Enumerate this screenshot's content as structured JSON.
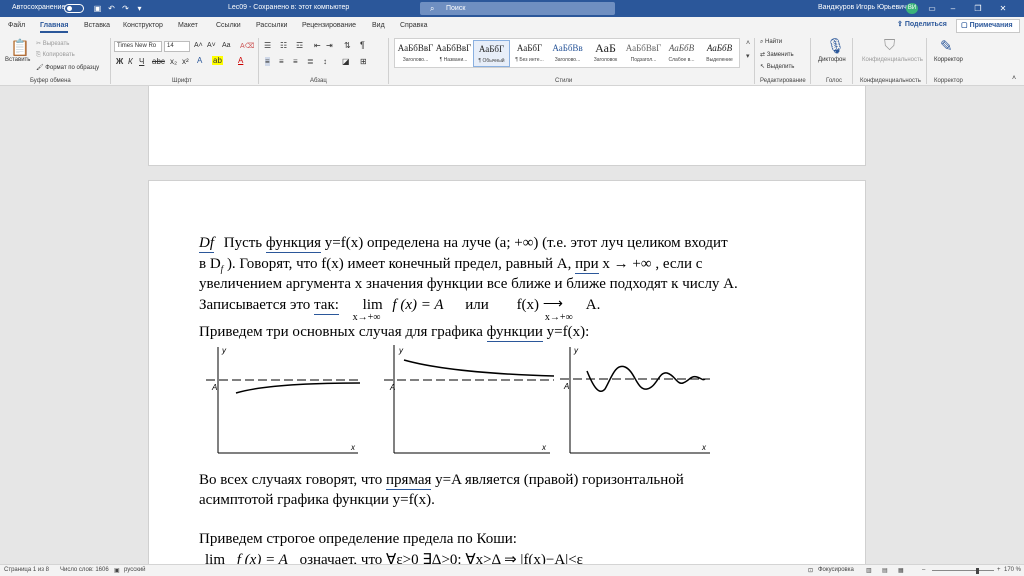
{
  "titlebar": {
    "autosave": "Автосохранение",
    "doc_title": "Lec09 - Сохранено в: этот компьютер",
    "search": "Поиск",
    "user": "Ванджуров Игорь Юрьевич",
    "avatar": "ВИ"
  },
  "tabs": [
    "Файл",
    "Главная",
    "Вставка",
    "Конструктор",
    "Макет",
    "Ссылки",
    "Рассылки",
    "Рецензирование",
    "Вид",
    "Справка"
  ],
  "share": "Поделиться",
  "notes": "Примечания",
  "ribbon": {
    "paste": "Вставить",
    "cut": "Вырезать",
    "copy": "Копировать",
    "format_painter": "Формат по образцу",
    "clipboard": "Буфер обмена",
    "font_name": "Times New Ro",
    "font_size": "14",
    "font_group": "Шрифт",
    "paragraph_group": "Абзац",
    "styles": [
      {
        "preview": "АаБбВвГ",
        "name": "Заголово..."
      },
      {
        "preview": "АаБбВвГ",
        "name": "¶ Названи..."
      },
      {
        "preview": "АаБбГ",
        "name": "¶ Обычный"
      },
      {
        "preview": "АаБбГ",
        "name": "¶ Без инте..."
      },
      {
        "preview": "АаБбВв",
        "name": "Заголово..."
      },
      {
        "preview": "АаБ",
        "name": "Заголовок"
      },
      {
        "preview": "АаБбВвГ",
        "name": "Подзагол..."
      },
      {
        "preview": "АаБбВ",
        "name": "Слабое в..."
      },
      {
        "preview": "АаБбВ",
        "name": "Выделение"
      }
    ],
    "styles_group": "Стили",
    "find": "Найти",
    "replace": "Заменить",
    "select": "Выделить",
    "editing_group": "Редактирование",
    "dictation": "Диктофон",
    "voice_group": "Голос",
    "sensitivity": "Конфиденциальность",
    "sensitivity_group": "Конфиденциальность",
    "editor": "Корректор",
    "editor_group": "Корректор"
  },
  "document": {
    "df": "Df",
    "line1_a": "Пусть",
    "line1_b": "функция",
    "line1_c": "y=f(x) определена на луче (a; +∞) (т.е. этот луч целиком входит",
    "line2_a": "в D",
    "line2_sub": "f",
    "line2_b": "). Говорят, что f(x) имеет конечный предел, равный A,",
    "line2_c": "при",
    "line2_d": "x → +∞ , если с",
    "line3": "увеличением аргумента x значения функции все ближе и ближе подходят к числу A.",
    "line4_a": "Записывается это",
    "line4_b": "так:",
    "lim": "lim",
    "lim_sub": "x→+∞",
    "lim_expr": "f (x) = A",
    "or": "или",
    "arrow_expr_a": "f(x)",
    "arrow_sub": "x→+∞",
    "arrow_expr_b": "A.",
    "line5_a": "Приведем три основных случая для графика",
    "line5_b": "функции",
    "line5_c": "y=f(x):",
    "graph_y": "y",
    "graph_x": "x",
    "graph_A": "A",
    "line6_a": "Во всех случаях говорят, что",
    "line6_b": "прямая",
    "line6_c": "y=A является (правой) горизонтальной",
    "line7": "асимптотой графика функции y=f(x).",
    "line8": "Приведем строгое определение предела по Коши:",
    "line9_lim": "lim",
    "line9_expr": "f (x) = A",
    "line9_rest": "означает, что ∀ε>0 ∃Δ>0: ∀x>Δ ⇒ |f(x)−A|<ε"
  },
  "status": {
    "page": "Страница 1 из 8",
    "words": "Число слов: 1606",
    "lang": "русский",
    "focus": "Фокусировка",
    "zoom": "170 %"
  }
}
